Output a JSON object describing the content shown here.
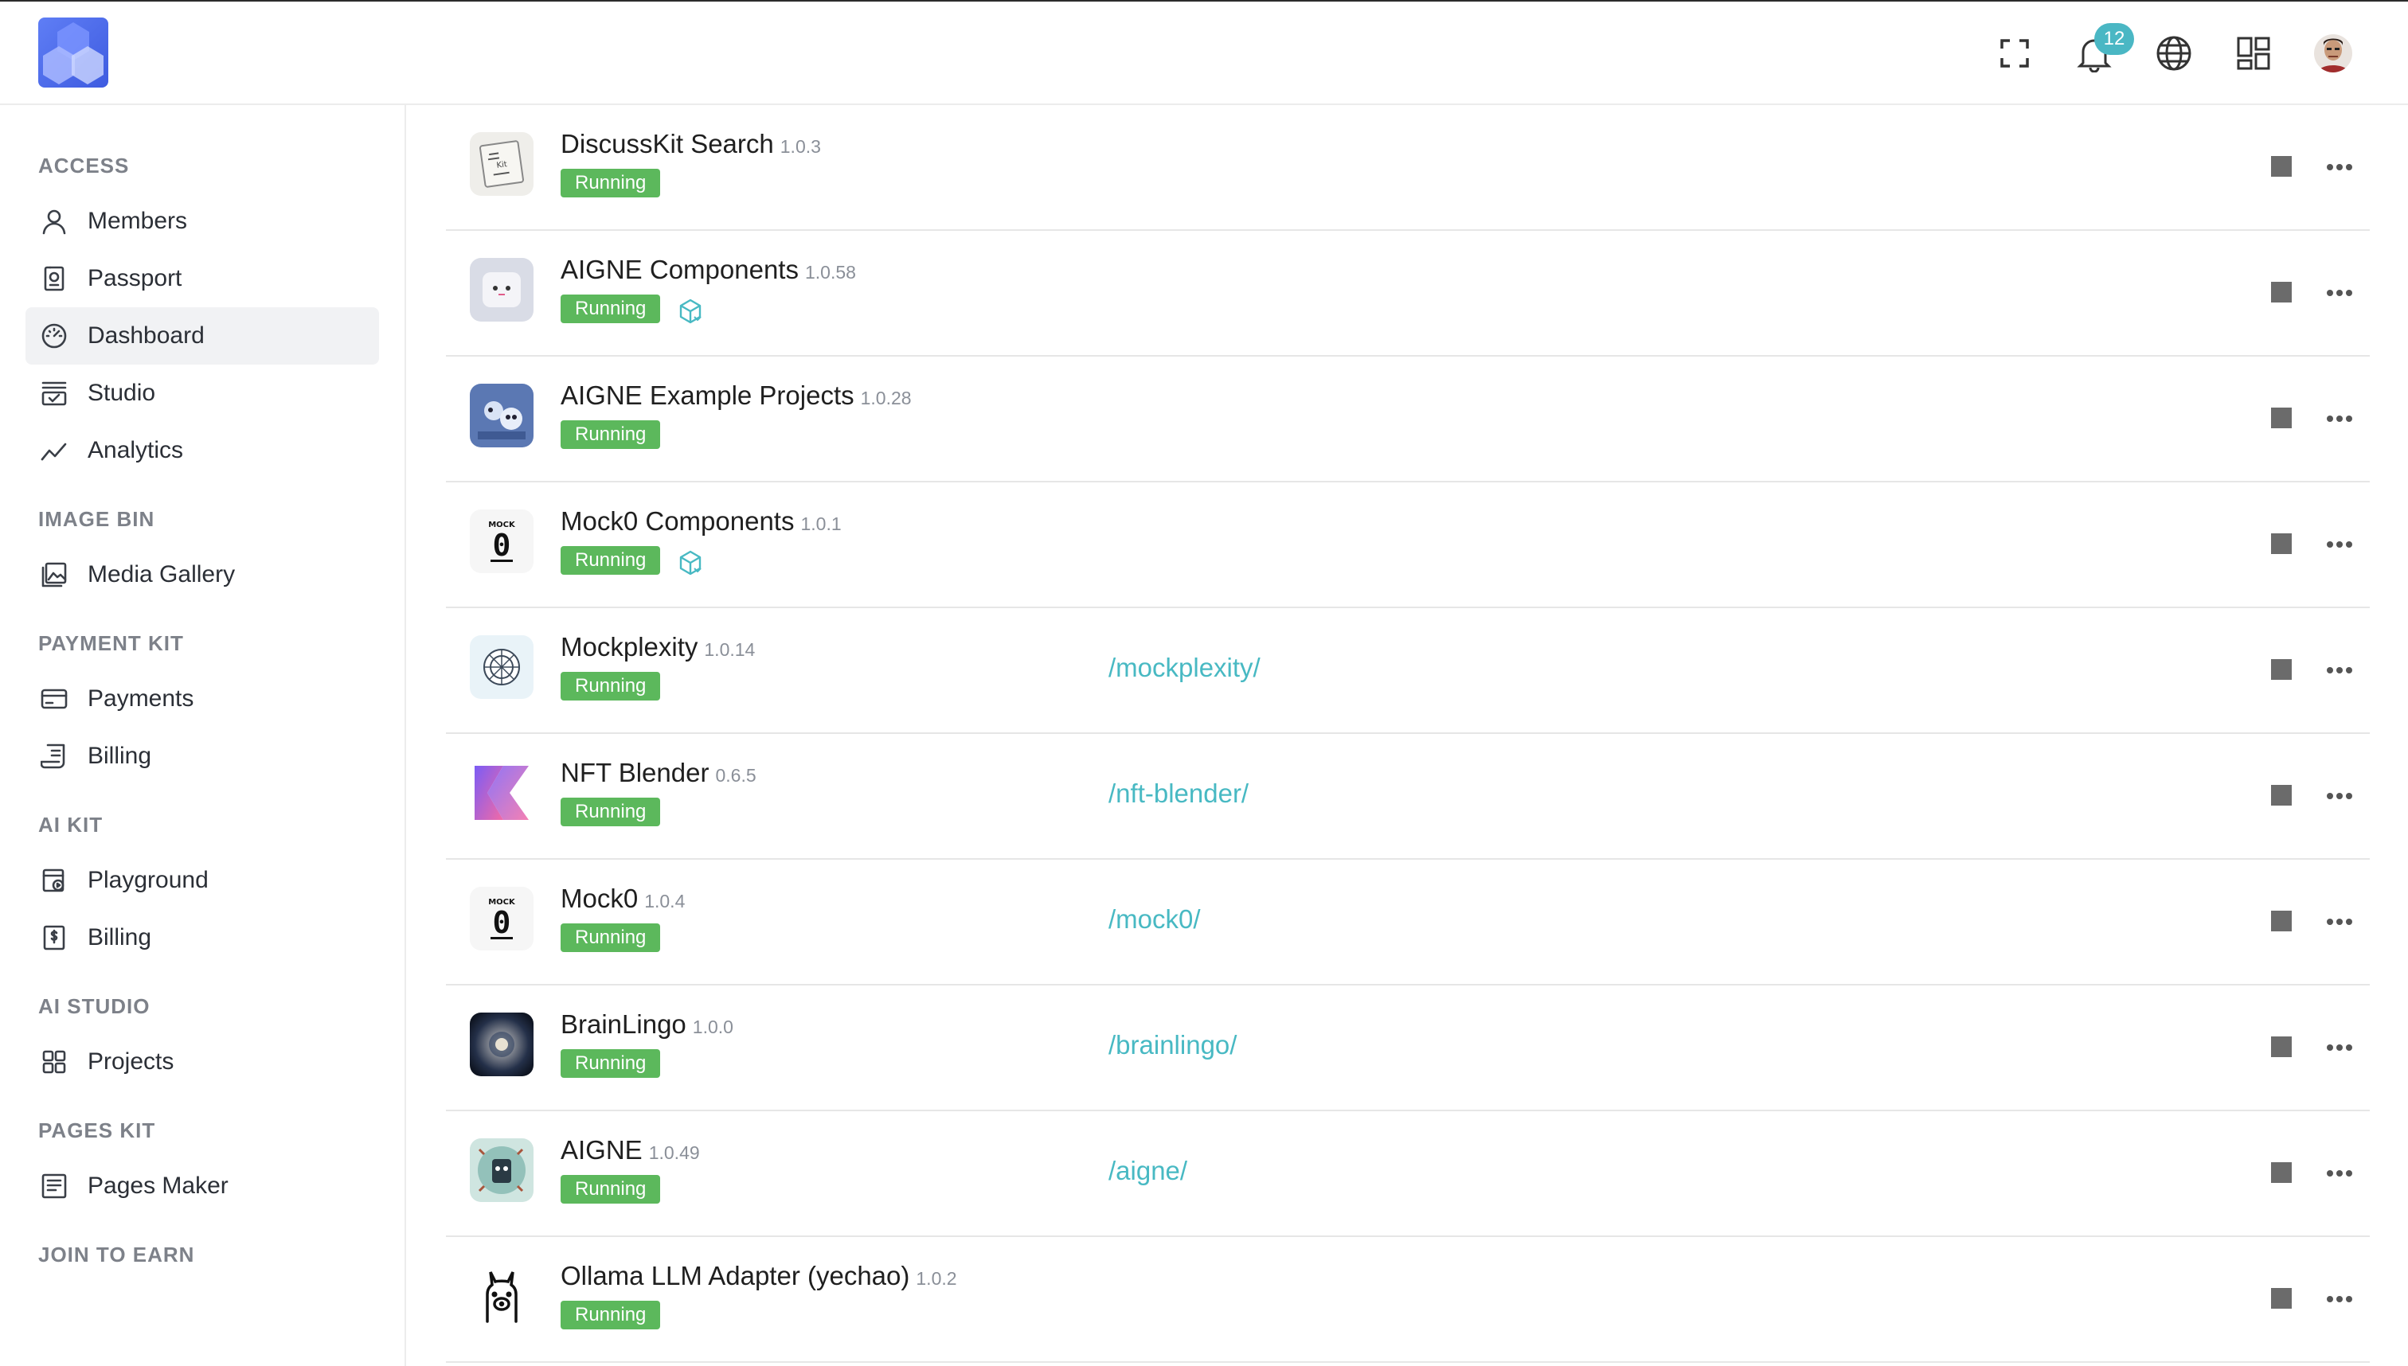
{
  "header": {
    "notifications_count": "12",
    "icons": [
      "fullscreen-icon",
      "bell-icon",
      "globe-icon",
      "app-grid-icon",
      "user-avatar"
    ]
  },
  "sidebar": {
    "sections": [
      {
        "title": "ACCESS",
        "items": [
          {
            "label": "Members",
            "icon": "person-icon"
          },
          {
            "label": "Passport",
            "icon": "passport-icon"
          },
          {
            "label": "Dashboard",
            "icon": "dashboard-icon",
            "active": true
          },
          {
            "label": "Studio",
            "icon": "studio-icon"
          },
          {
            "label": "Analytics",
            "icon": "analytics-icon"
          }
        ]
      },
      {
        "title": "IMAGE BIN",
        "items": [
          {
            "label": "Media Gallery",
            "icon": "gallery-icon"
          }
        ]
      },
      {
        "title": "PAYMENT KIT",
        "items": [
          {
            "label": "Payments",
            "icon": "card-icon"
          },
          {
            "label": "Billing",
            "icon": "receipt-icon"
          }
        ]
      },
      {
        "title": "AI KIT",
        "items": [
          {
            "label": "Playground",
            "icon": "playground-icon"
          },
          {
            "label": "Billing",
            "icon": "dollar-receipt-icon"
          }
        ]
      },
      {
        "title": "AI STUDIO",
        "items": [
          {
            "label": "Projects",
            "icon": "grid-icon"
          }
        ]
      },
      {
        "title": "PAGES KIT",
        "items": [
          {
            "label": "Pages Maker",
            "icon": "pages-icon"
          }
        ]
      },
      {
        "title": "JOIN TO EARN",
        "items": []
      }
    ]
  },
  "apps": [
    {
      "name": "DiscussKit Search",
      "version": "1.0.3",
      "status": "Running",
      "link": "",
      "component": false,
      "logo": "discusskit-logo"
    },
    {
      "name": "AIGNE Components",
      "version": "1.0.58",
      "status": "Running",
      "link": "",
      "component": true,
      "logo": "aigne-components-logo"
    },
    {
      "name": "AIGNE Example Projects",
      "version": "1.0.28",
      "status": "Running",
      "link": "",
      "component": false,
      "logo": "aigne-examples-logo"
    },
    {
      "name": "Mock0 Components",
      "version": "1.0.1",
      "status": "Running",
      "link": "",
      "component": true,
      "logo": "mock0-logo"
    },
    {
      "name": "Mockplexity",
      "version": "1.0.14",
      "status": "Running",
      "link": "/mockplexity/",
      "component": false,
      "logo": "mockplexity-logo"
    },
    {
      "name": "NFT Blender",
      "version": "0.6.5",
      "status": "Running",
      "link": "/nft-blender/",
      "component": false,
      "logo": "nft-blender-logo"
    },
    {
      "name": "Mock0",
      "version": "1.0.4",
      "status": "Running",
      "link": "/mock0/",
      "component": false,
      "logo": "mock0-logo"
    },
    {
      "name": "BrainLingo",
      "version": "1.0.0",
      "status": "Running",
      "link": "/brainlingo/",
      "component": false,
      "logo": "brainlingo-logo"
    },
    {
      "name": "AIGNE",
      "version": "1.0.49",
      "status": "Running",
      "link": "/aigne/",
      "component": false,
      "logo": "aigne-logo"
    },
    {
      "name": "Ollama LLM Adapter (yechao)",
      "version": "1.0.2",
      "status": "Running",
      "link": "",
      "component": false,
      "logo": "ollama-logo"
    }
  ],
  "colors": {
    "running": "#5cb85c",
    "link": "#48b9c3",
    "badge": "#4ab7c4",
    "brand": "#4a68ea"
  }
}
